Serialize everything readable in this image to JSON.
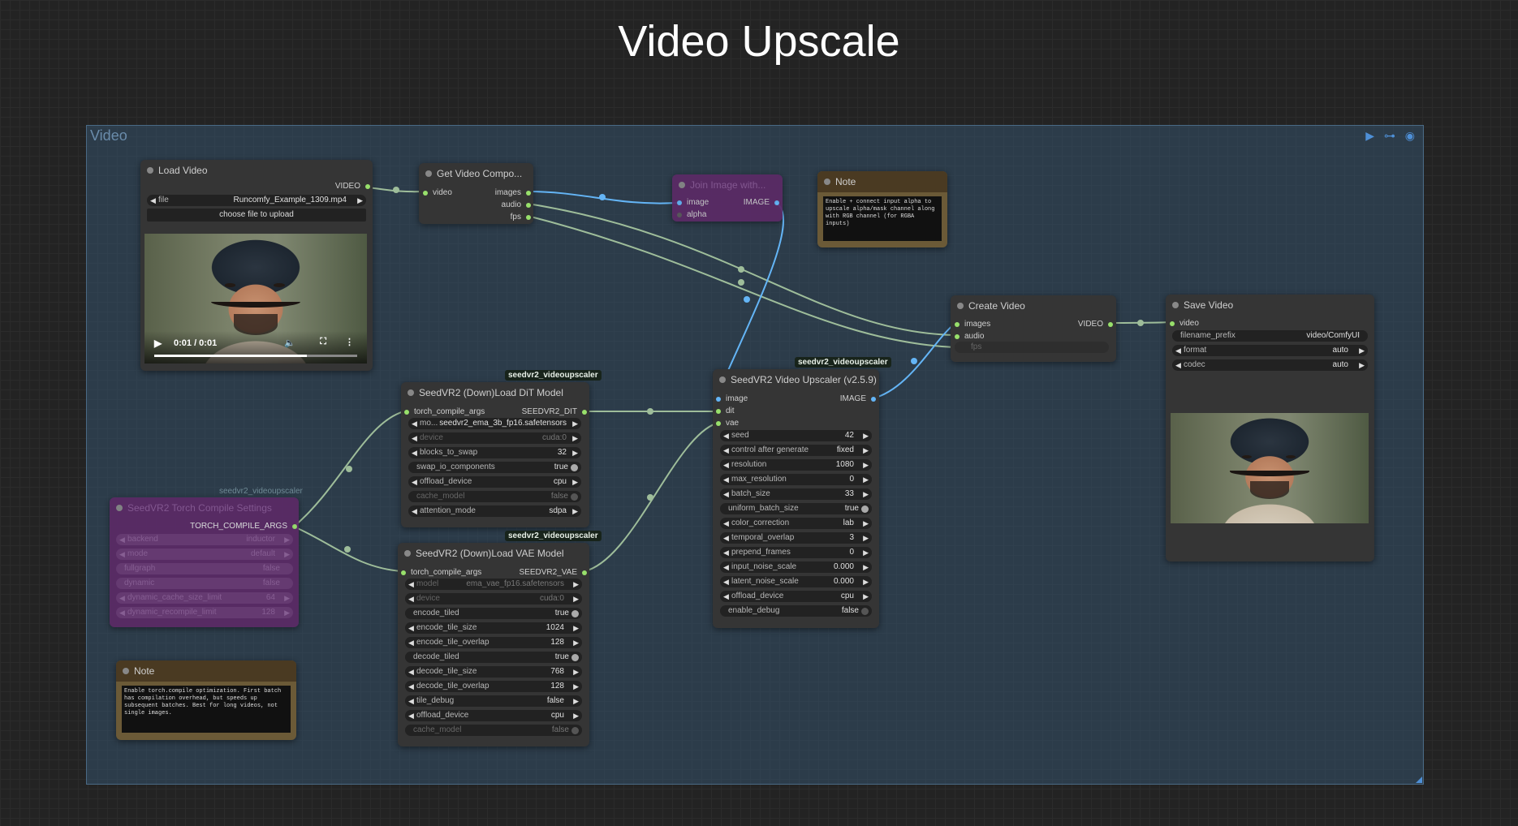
{
  "page_title": "Video Upscale",
  "group": {
    "title": "Video",
    "controls": [
      "▶",
      "⊶",
      "◉"
    ]
  },
  "colors": {
    "link_green": "#9ebd9a",
    "link_blue": "#64b5f6",
    "group_bg": "#34526c",
    "purple_node": "#5b2a66",
    "note_header": "#4a3a22"
  },
  "load_video": {
    "title": "Load Video",
    "out_video": "VIDEO",
    "file_label": "file",
    "file_value": "Runcomfy_Example_1309.mp4",
    "upload_button": "choose file to upload",
    "player": {
      "time": "0:01 / 0:01",
      "progress": 0.75
    }
  },
  "get_components": {
    "title": "Get Video Compo...",
    "in_video": "video",
    "out_images": "images",
    "out_audio": "audio",
    "out_fps": "fps"
  },
  "join_alpha": {
    "title": "Join Image with...",
    "in_image": "image",
    "in_alpha": "alpha",
    "out_image": "IMAGE"
  },
  "note_alpha": {
    "title": "Note",
    "text": "Enable + connect input alpha to upscale alpha/mask channel along with RGB channel (for RGBA inputs)"
  },
  "create_video": {
    "title": "Create Video",
    "in_images": "images",
    "in_audio": "audio",
    "in_fps": "fps",
    "out_video": "VIDEO"
  },
  "save_video": {
    "title": "Save Video",
    "in_video": "video",
    "widgets": [
      {
        "label": "filename_prefix",
        "value": "video/ComfyUI"
      },
      {
        "label": "format",
        "value": "auto"
      },
      {
        "label": "codec",
        "value": "auto"
      }
    ]
  },
  "dit_model": {
    "tag": "seedvr2_videoupscaler",
    "title": "SeedVR2 (Down)Load DiT Model",
    "in_torch": "torch_compile_args",
    "out": "SEEDVR2_DIT",
    "widgets": [
      {
        "label": "mo...",
        "value": "seedvr2_ema_3b_fp16.safetensors"
      },
      {
        "label": "device",
        "value": "cuda:0"
      },
      {
        "label": "blocks_to_swap",
        "value": "32"
      },
      {
        "label": "swap_io_components",
        "value": "true"
      },
      {
        "label": "offload_device",
        "value": "cpu"
      },
      {
        "label": "cache_model",
        "value": "false"
      },
      {
        "label": "attention_mode",
        "value": "sdpa"
      }
    ]
  },
  "vae_model": {
    "tag": "seedvr2_videoupscaler",
    "title": "SeedVR2 (Down)Load VAE Model",
    "in_torch": "torch_compile_args",
    "out": "SEEDVR2_VAE",
    "widgets": [
      {
        "label": "model",
        "value": "ema_vae_fp16.safetensors"
      },
      {
        "label": "device",
        "value": "cuda:0"
      },
      {
        "label": "encode_tiled",
        "value": "true"
      },
      {
        "label": "encode_tile_size",
        "value": "1024"
      },
      {
        "label": "encode_tile_overlap",
        "value": "128"
      },
      {
        "label": "decode_tiled",
        "value": "true"
      },
      {
        "label": "decode_tile_size",
        "value": "768"
      },
      {
        "label": "decode_tile_overlap",
        "value": "128"
      },
      {
        "label": "tile_debug",
        "value": "false"
      },
      {
        "label": "offload_device",
        "value": "cpu"
      },
      {
        "label": "cache_model",
        "value": "false"
      }
    ]
  },
  "upscaler": {
    "tag": "seedvr2_videoupscaler",
    "title": "SeedVR2 Video Upscaler (v2.5.9)",
    "in_image": "image",
    "in_dit": "dit",
    "in_vae": "vae",
    "out": "IMAGE",
    "widgets": [
      {
        "label": "seed",
        "value": "42"
      },
      {
        "label": "control after generate",
        "value": "fixed"
      },
      {
        "label": "resolution",
        "value": "1080"
      },
      {
        "label": "max_resolution",
        "value": "0"
      },
      {
        "label": "batch_size",
        "value": "33"
      },
      {
        "label": "uniform_batch_size",
        "value": "true"
      },
      {
        "label": "color_correction",
        "value": "lab"
      },
      {
        "label": "temporal_overlap",
        "value": "3"
      },
      {
        "label": "prepend_frames",
        "value": "0"
      },
      {
        "label": "input_noise_scale",
        "value": "0.000"
      },
      {
        "label": "latent_noise_scale",
        "value": "0.000"
      },
      {
        "label": "offload_device",
        "value": "cpu"
      },
      {
        "label": "enable_debug",
        "value": "false"
      }
    ]
  },
  "torch_settings": {
    "tag": "seedvr2_videoupscaler",
    "title": "SeedVR2 Torch Compile Settings",
    "out": "TORCH_COMPILE_ARGS",
    "widgets": [
      {
        "label": "backend",
        "value": "inductor"
      },
      {
        "label": "mode",
        "value": "default"
      },
      {
        "label": "fullgraph",
        "value": "false"
      },
      {
        "label": "dynamic",
        "value": "false"
      },
      {
        "label": "dynamic_cache_size_limit",
        "value": "64"
      },
      {
        "label": "dynamic_recompile_limit",
        "value": "128"
      }
    ]
  },
  "note_torch": {
    "title": "Note",
    "text": "Enable torch.compile optimization. First batch has compilation overhead, but speeds up subsequent batches. Best for long videos, not single images."
  }
}
